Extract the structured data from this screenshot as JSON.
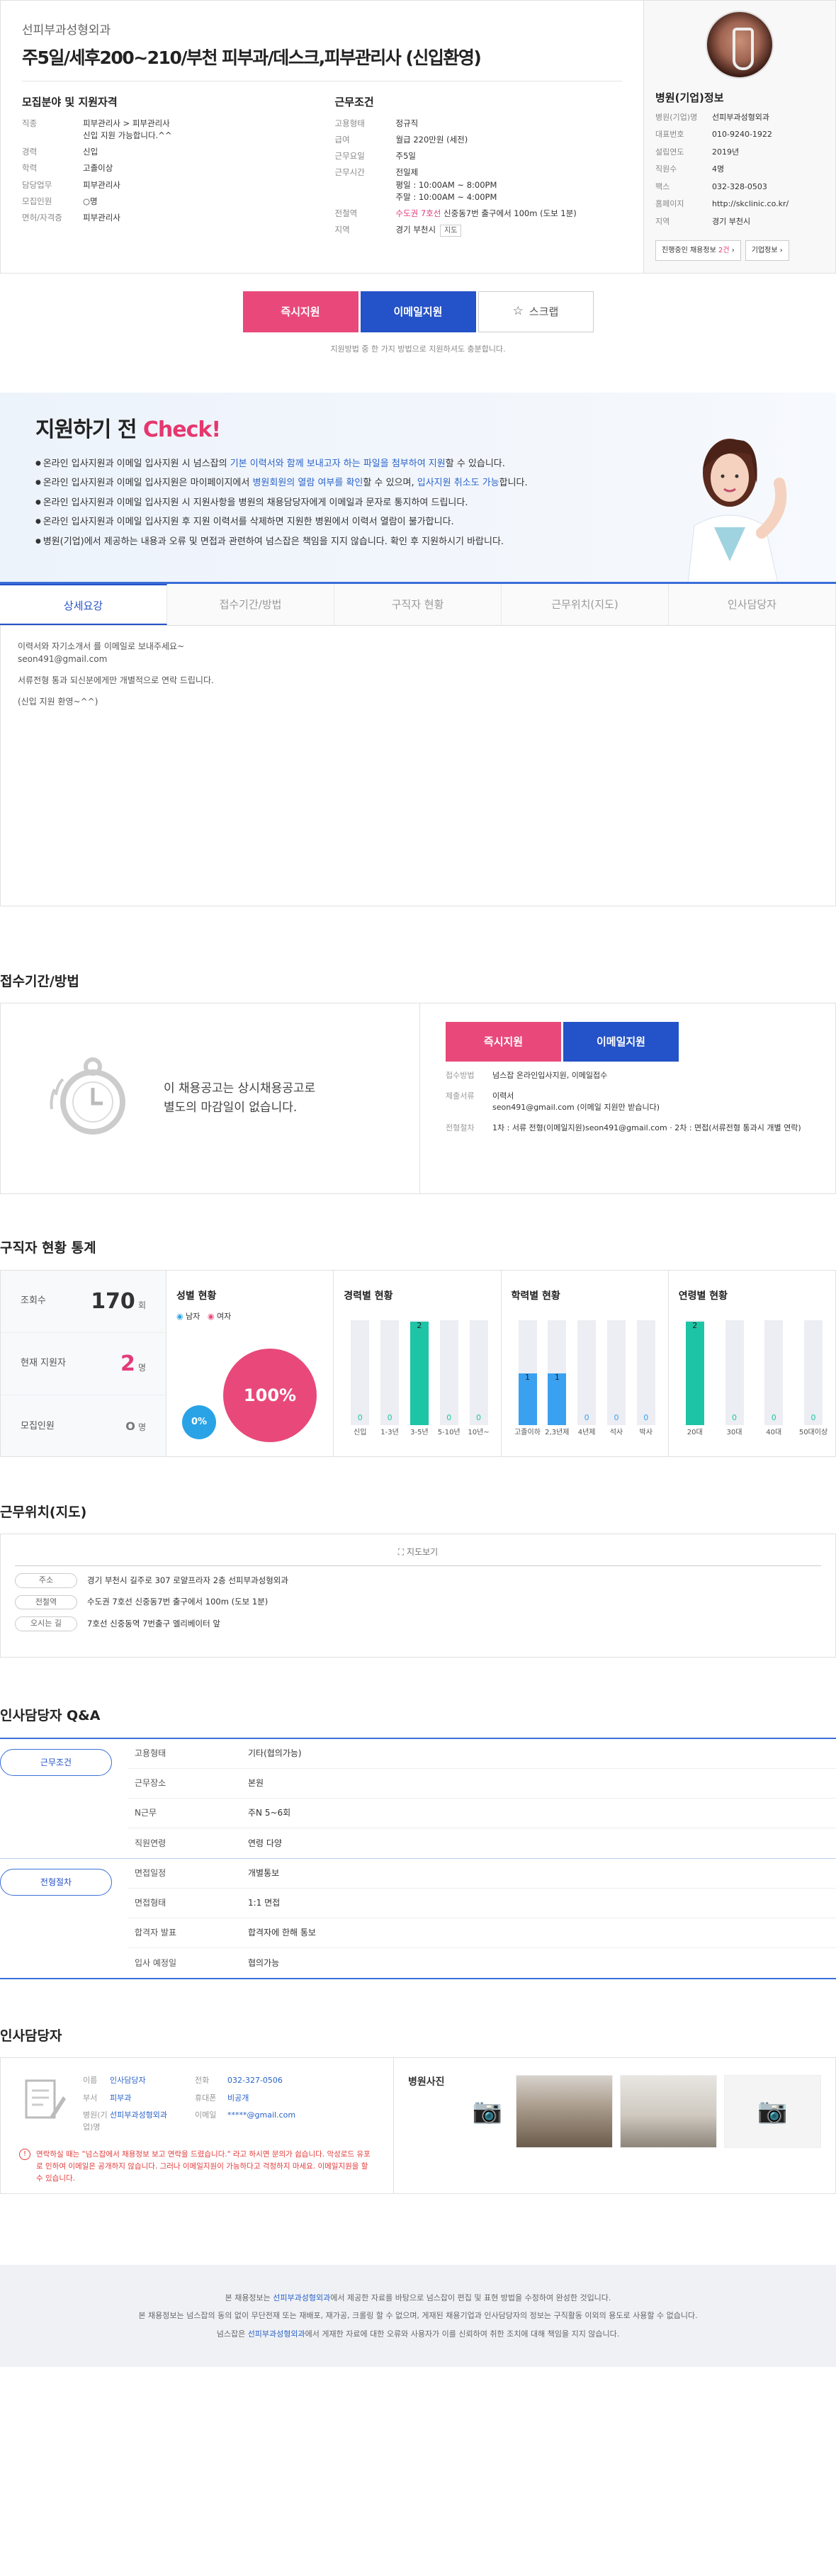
{
  "header": {
    "company": "선피부과성형외과",
    "title": "주5일/세후200~210/부천 피부과/데스크,피부관리사 (신입환영)"
  },
  "recruit": {
    "heading": "모집분야 및 지원자격",
    "rows": [
      {
        "k": "직종",
        "v": "피부관리사 > 피부관리사",
        "v2": "신입 지원 가능합니다.^^"
      },
      {
        "k": "경력",
        "v": "신입",
        "color": "blue"
      },
      {
        "k": "학력",
        "v": "고졸이상",
        "color": "blue"
      },
      {
        "k": "담당업무",
        "v": "피부관리사"
      },
      {
        "k": "모집인원",
        "v": "○명"
      },
      {
        "k": "면허/자격증",
        "v": "피부관리사"
      }
    ]
  },
  "condition": {
    "heading": "근무조건",
    "rows": [
      {
        "k": "고용형태",
        "v": "정규직",
        "color": "blue"
      },
      {
        "k": "급여",
        "v": "월급 220만원 (세전)"
      },
      {
        "k": "근무요일",
        "v": "주5일"
      },
      {
        "k": "근무시간",
        "v": "전일제",
        "v2": "평일 : 10:00AM ~ 8:00PM",
        "v3": "주말 : 10:00AM ~ 4:00PM"
      },
      {
        "k": "전철역",
        "v_pink": "수도권 7호선",
        "v": "신중동7번 출구에서 100m (도보 1분)"
      },
      {
        "k": "지역",
        "v": "경기 부천시",
        "btn": "지도"
      }
    ]
  },
  "hospital": {
    "heading": "병원(기업)정보",
    "rows": [
      {
        "k": "병원(기업)명",
        "v": "선피부과성형외과"
      },
      {
        "k": "대표번호",
        "v": "010-9240-1922"
      },
      {
        "k": "설립연도",
        "v": "2019년"
      },
      {
        "k": "직원수",
        "v": "4명"
      },
      {
        "k": "팩스",
        "v": "032-328-0503"
      },
      {
        "k": "홈페이지",
        "v": "http://skclinic.co.kr/",
        "color": "blue"
      },
      {
        "k": "지역",
        "v": "경기 부천시"
      }
    ],
    "btn_jobs_pre": "진행중인 채용정보",
    "btn_jobs_count": "2건",
    "btn_info": "기업정보"
  },
  "apply": {
    "instant": "즉시지원",
    "email": "이메일지원",
    "scrap": "스크랩",
    "note": "지원방법 중 한 가지 방법으로 지원하셔도 충분합니다."
  },
  "check": {
    "title": "지원하기 전",
    "title_hl": "Check!",
    "items": [
      {
        "a": "온라인 입사지원과 이메일 입사지원 시 넘스잡의 ",
        "hl": "기본 이력서와 함께 보내고자 하는 파일을 첨부하여 지원",
        "b": "할 수 있습니다."
      },
      {
        "a": "온라인 입사지원과 이메일 입사지원은 마이페이지에서 ",
        "hl": "병원회원의 열람 여부를 확인",
        "b": "할 수 있으며, ",
        "hl2": "입사지원 취소도 가능",
        "c": "합니다."
      },
      {
        "a": "온라인 입사지원과 이메일 입사지원 시 지원사항을 병원의 채용담당자에게 이메일과 문자로 통지하여 드립니다.",
        "hl": "",
        "b": ""
      },
      {
        "a": "온라인 입사지원과 이메일 입사지원 후 지원 이력서를 삭제하면 지원한 병원에서 이력서 열람이 불가합니다.",
        "hl": "",
        "b": ""
      },
      {
        "a": "병원(기업)에서 제공하는 내용과 오류 및 면접과 관련하여 넘스잡은 책임을 지지 않습니다. 확인 후 지원하시기 바랍니다.",
        "hl": "",
        "b": ""
      }
    ]
  },
  "tabs": [
    "상세요강",
    "접수기간/방법",
    "구직자 현황",
    "근무위치(지도)",
    "인사담당자"
  ],
  "detail": {
    "l1": "이력서와 자기소개서 를 이메일로 보내주세요~",
    "l2": "seon491@gmail.com",
    "l3": "서류전형 통과 되신분에게만 개별적으로 연락 드립니다.",
    "l4": "(신입 지원 환영~^^)"
  },
  "period": {
    "title": "접수기간/방법",
    "msg1": "이 채용공고는 상시채용공고로",
    "msg2": "별도의 마감일이 없습니다.",
    "instant": "즉시지원",
    "email": "이메일지원",
    "rows": [
      {
        "k": "접수방법",
        "v": "넘스잡 온라인입사지원, 이메일접수"
      },
      {
        "k": "제출서류",
        "v": "이력서",
        "v2": "seon491@gmail.com (이메일 지원만 받습니다)"
      },
      {
        "k": "전형절차",
        "v": "1차 : 서류 전형(이메일지원)seon491@gmail.com · 2차 : 면접(서류전형 통과시 개별 연락)"
      }
    ]
  },
  "stats": {
    "title": "구직자 현황 통계",
    "views_label": "조회수",
    "views": "170",
    "views_unit": "회",
    "applicants_label": "현재 지원자",
    "applicants": "2",
    "applicants_unit": "명",
    "recruit_label": "모집인원",
    "recruit": "O",
    "recruit_unit": "명",
    "gender_title": "성별 현황",
    "male": "남자",
    "female": "여자",
    "male_pct": "0%",
    "female_pct": "100%",
    "career_title": "경력별 현황",
    "edu_title": "학력별 현황",
    "age_title": "연령별 현황"
  },
  "chart_data": [
    {
      "type": "bar",
      "title": "경력별 현황",
      "categories": [
        "신입",
        "1-3년",
        "3-5년",
        "5-10년",
        "10년~"
      ],
      "values": [
        0,
        0,
        2,
        0,
        0
      ]
    },
    {
      "type": "bar",
      "title": "학력별 현황",
      "categories": [
        "고졸이하",
        "2,3년제",
        "4년제",
        "석사",
        "박사"
      ],
      "values": [
        1,
        1,
        0,
        0,
        0
      ]
    },
    {
      "type": "bar",
      "title": "연령별 현황",
      "categories": [
        "20대",
        "30대",
        "40대",
        "50대이상"
      ],
      "values": [
        2,
        0,
        0,
        0
      ]
    }
  ],
  "location": {
    "title": "근무위치(지도)",
    "map_btn": "지도보기",
    "rows": [
      {
        "k": "주소",
        "v": "경기 부천시 길주로 307 로얄프라자 2층 선피부과성형외과"
      },
      {
        "k": "전철역",
        "v": "수도권 7호선 신중동7번 출구에서 100m (도보 1분)"
      },
      {
        "k": "오시는 길",
        "v": "7호선 신중동역 7번출구 엘리베이터 앞"
      }
    ]
  },
  "qa": {
    "title": "인사담당자 Q&A",
    "groups": [
      {
        "tag": "근무조건",
        "rows": [
          {
            "k": "고용형태",
            "v": "기타(협의가능)"
          },
          {
            "k": "근무장소",
            "v": "본원"
          },
          {
            "k": "N근무",
            "v": "주N 5~6회"
          },
          {
            "k": "직원연령",
            "v": "연령 다양"
          }
        ]
      },
      {
        "tag": "전형절차",
        "rows": [
          {
            "k": "면접일정",
            "v": "개별통보"
          },
          {
            "k": "면접형태",
            "v": "1:1 면접"
          },
          {
            "k": "합격자 발표",
            "v": "합격자에 한해 통보"
          },
          {
            "k": "입사 예정일",
            "v": "협의가능"
          }
        ]
      }
    ]
  },
  "hr": {
    "title": "인사담당자",
    "name_k": "이름",
    "name": "인사담당자",
    "dept_k": "부서",
    "dept": "피부과",
    "org_k": "병원(기업)명",
    "org": "선피부과성형외과",
    "tel_k": "전화",
    "tel": "032-327-0506",
    "mobile_k": "휴대폰",
    "mobile": "비공개",
    "email_k": "이메일",
    "email": "*****@gmail.com",
    "notice": "연락하실 때는 \"넘스잡에서 채용정보 보고 연락을 드렸습니다.\" 라고 하시면 문의가 쉽습니다. 악성로드 유포로 인하여 이메일은 공개하지 않습니다. 그러나 이메일지원이 가능하다고 걱정하지 마세요. 이메일지원을 할 수 있습니다.",
    "photos_title": "병원사진"
  },
  "footer": {
    "l1a": "본 채용정보는 ",
    "l1b": "선피부과성형외과",
    "l1c": "에서 제공한 자료를 바탕으로 넘스잡이 편집 및 표현 방법을 수정하여 완성한 것입니다.",
    "l2": "본 채용정보는 넘스잡의 동의 없이 무단전재 또는 재배포, 재가공, 크롤링 할 수 없으며, 게재된 채용기업과 인사담당자의 정보는 구직활동 이외의 용도로 사용할 수 없습니다.",
    "l3a": "넘스잡은 ",
    "l3b": "선피부과성형외과",
    "l3c": "에서 게재한 자료에 대한 오류와 사용자가 이를 신뢰하여 취한 조치에 대해 책임을 지지 않습니다."
  }
}
